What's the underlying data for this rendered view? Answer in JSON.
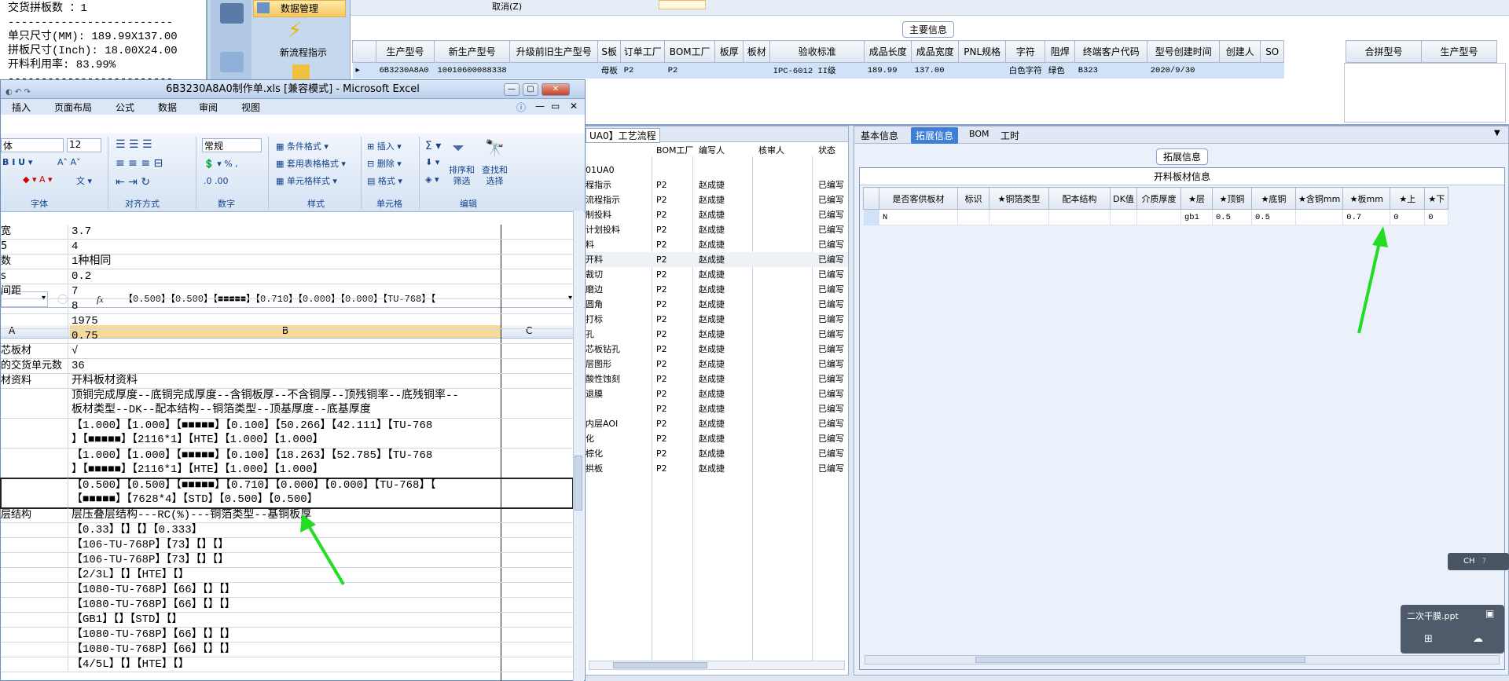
{
  "notepad": {
    "lines": [
      "交货拼板数 ：1",
      "-------------------------",
      "单只尺寸(MM): 189.99X137.00",
      "拼板尺寸(Inch): 18.00X24.00",
      "开料利用率: 83.99%",
      "-------------------------"
    ]
  },
  "nav": {
    "data_mgmt": "数据管理",
    "new_flow": "新流程指示"
  },
  "top": {
    "cancel_label": "取消(Z)",
    "section_title": "主要信息",
    "headers": [
      "生产型号",
      "新生产型号",
      "升级前旧生产型号",
      "S板",
      "订单工厂",
      "BOM工厂",
      "板厚",
      "板材",
      "验收标准",
      "成品长度",
      "成品宽度",
      "PNL规格",
      "字符",
      "阻焊",
      "终端客户代码",
      "型号创建时间",
      "创建人",
      "SO"
    ],
    "row": [
      "6B3230A8A0",
      "10010600088338",
      "",
      "母板",
      "P2",
      "P2",
      "",
      "",
      "IPC-6012 II级",
      "189.99",
      "137.00",
      "",
      "白色字符",
      "绿色",
      "B323",
      "2020/9/30",
      "",
      ""
    ],
    "side_headers": [
      "合拼型号",
      "生产型号"
    ]
  },
  "mid": {
    "tab_label": "UA0】工艺流程",
    "headers": [
      "BOM工厂",
      "编写人",
      "核审人",
      "状态"
    ],
    "first": "01UA0",
    "rows": [
      {
        "name": "程指示",
        "f": "P2",
        "w": "赵成捷",
        "s": "已编写"
      },
      {
        "name": "流程指示",
        "f": "P2",
        "w": "赵成捷",
        "s": "已编写"
      },
      {
        "name": "制投料",
        "f": "P2",
        "w": "赵成捷",
        "s": "已编写"
      },
      {
        "name": "计划投料",
        "f": "P2",
        "w": "赵成捷",
        "s": "已编写"
      },
      {
        "name": "料",
        "f": "P2",
        "w": "赵成捷",
        "s": "已编写"
      },
      {
        "name": "开料",
        "f": "P2",
        "w": "赵成捷",
        "s": "已编写"
      },
      {
        "name": "裁切",
        "f": "P2",
        "w": "赵成捷",
        "s": "已编写"
      },
      {
        "name": "磨边",
        "f": "P2",
        "w": "赵成捷",
        "s": "已编写"
      },
      {
        "name": "圆角",
        "f": "P2",
        "w": "赵成捷",
        "s": "已编写"
      },
      {
        "name": "打标",
        "f": "P2",
        "w": "赵成捷",
        "s": "已编写"
      },
      {
        "name": "孔",
        "f": "P2",
        "w": "赵成捷",
        "s": "已编写"
      },
      {
        "name": "芯板钻孔",
        "f": "P2",
        "w": "赵成捷",
        "s": "已编写"
      },
      {
        "name": "层图形",
        "f": "P2",
        "w": "赵成捷",
        "s": "已编写"
      },
      {
        "name": "酸性蚀刻",
        "f": "P2",
        "w": "赵成捷",
        "s": "已编写"
      },
      {
        "name": "退膜",
        "f": "P2",
        "w": "赵成捷",
        "s": "已编写"
      },
      {
        "name": "",
        "f": "P2",
        "w": "赵成捷",
        "s": "已编写"
      },
      {
        "name": "内层AOI",
        "f": "P2",
        "w": "赵成捷",
        "s": "已编写"
      },
      {
        "name": "化",
        "f": "P2",
        "w": "赵成捷",
        "s": "已编写"
      },
      {
        "name": "棕化",
        "f": "P2",
        "w": "赵成捷",
        "s": "已编写"
      },
      {
        "name": "拱板",
        "f": "P2",
        "w": "赵成捷",
        "s": "已编写"
      }
    ]
  },
  "right": {
    "tabs": [
      "基本信息",
      "拓展信息",
      "BOM",
      "工时"
    ],
    "section": "拓展信息",
    "sub": "开料板材信息",
    "headers": [
      "是否客供板材",
      "标识",
      "★铜箔类型",
      "配本结构",
      "DK值",
      "介质厚度",
      "★层",
      "★顶铜",
      "★底铜",
      "★含铜mm",
      "★板mm",
      "★上",
      "★下"
    ],
    "row": [
      "N",
      "",
      "",
      "",
      "",
      "",
      "gb1",
      "0.5",
      "0.5",
      "",
      "0.7",
      "0",
      "0"
    ]
  },
  "ime": {
    "label": "CH"
  },
  "popup": {
    "file": "二次干膜.ppt"
  },
  "excel": {
    "title": "6B3230A8A0制作单.xls  [兼容模式] - Microsoft Excel",
    "menu": [
      "插入",
      "页面布局",
      "公式",
      "数据",
      "审阅",
      "视图"
    ],
    "font_name": "体",
    "font_size": "12",
    "number_format": "常规",
    "groups": [
      "字体",
      "对齐方式",
      "数字",
      "样式",
      "单元格",
      "编辑"
    ],
    "style_items": [
      "条件格式",
      "套用表格格式",
      "单元格样式"
    ],
    "cell_items": [
      "插入",
      "删除",
      "格式"
    ],
    "edit_items": [
      "排序和\n筛选",
      "查找和\n选择"
    ],
    "formula": "【0.500】【0.500】【■■■■■】【0.710】【0.000】【0.000】【TU-768】【",
    "col_a": "A",
    "col_b": "B",
    "col_c": "C",
    "rows": [
      {
        "a": "宽",
        "b": "3.7"
      },
      {
        "a": "5",
        "b": "4"
      },
      {
        "a": "数",
        "b": "1种相同"
      },
      {
        "a": "s",
        "b": "0.2"
      },
      {
        "a": "间距",
        "b": "7"
      },
      {
        "a": "",
        "b": "8"
      },
      {
        "a": "",
        "b": "1975"
      },
      {
        "a": "",
        "b": "0.75"
      },
      {
        "a": "芯板材",
        "b": "√"
      },
      {
        "a": "的交货单元数",
        "b": "36"
      },
      {
        "a": "材资料",
        "b": "开料板材资料"
      },
      {
        "a": "",
        "b": "顶铜完成厚度--底铜完成厚度--含铜板厚--不含铜厚--顶残铜率--底残铜率--",
        "b2": "板材类型--DK--配本结构--铜箔类型--顶基厚度--底基厚度"
      },
      {
        "a": "",
        "b": "【1.000】【1.000】【■■■■■】【0.100】【50.266】【42.111】【TU-768",
        "b2": "】【■■■■■】【2116*1】【HTE】【1.000】【1.000】"
      },
      {
        "a": "",
        "b": "【1.000】【1.000】【■■■■■】【0.100】【18.263】【52.785】【TU-768",
        "b2": "】【■■■■■】【2116*1】【HTE】【1.000】【1.000】"
      },
      {
        "a": "",
        "b": "【0.500】【0.500】【■■■■■】【0.710】【0.000】【0.000】【TU-768】【",
        "b2": "【■■■■■】【7628*4】【STD】【0.500】【0.500】"
      },
      {
        "a": "层结构",
        "b": "层压叠层结构---RC(%)---铜箔类型--基铜板厚"
      },
      {
        "a": "",
        "b": "【0.33】【】【】【0.333】"
      },
      {
        "a": "",
        "b": "【106-TU-768P】【73】【】【】"
      },
      {
        "a": "",
        "b": "【106-TU-768P】【73】【】【】"
      },
      {
        "a": "",
        "b": "【2/3L】【】【HTE】【】"
      },
      {
        "a": "",
        "b": "【1080-TU-768P】【66】【】【】"
      },
      {
        "a": "",
        "b": "【1080-TU-768P】【66】【】【】"
      },
      {
        "a": "",
        "b": "【GB1】【】【STD】【】"
      },
      {
        "a": "",
        "b": "【1080-TU-768P】【66】【】【】"
      },
      {
        "a": "",
        "b": "【1080-TU-768P】【66】【】【】"
      },
      {
        "a": "",
        "b": "【4/5L】【】【HTE】【】"
      }
    ]
  },
  "colors": {
    "arrow": "#22dd22",
    "selected_tab": "#3d7fd6"
  }
}
